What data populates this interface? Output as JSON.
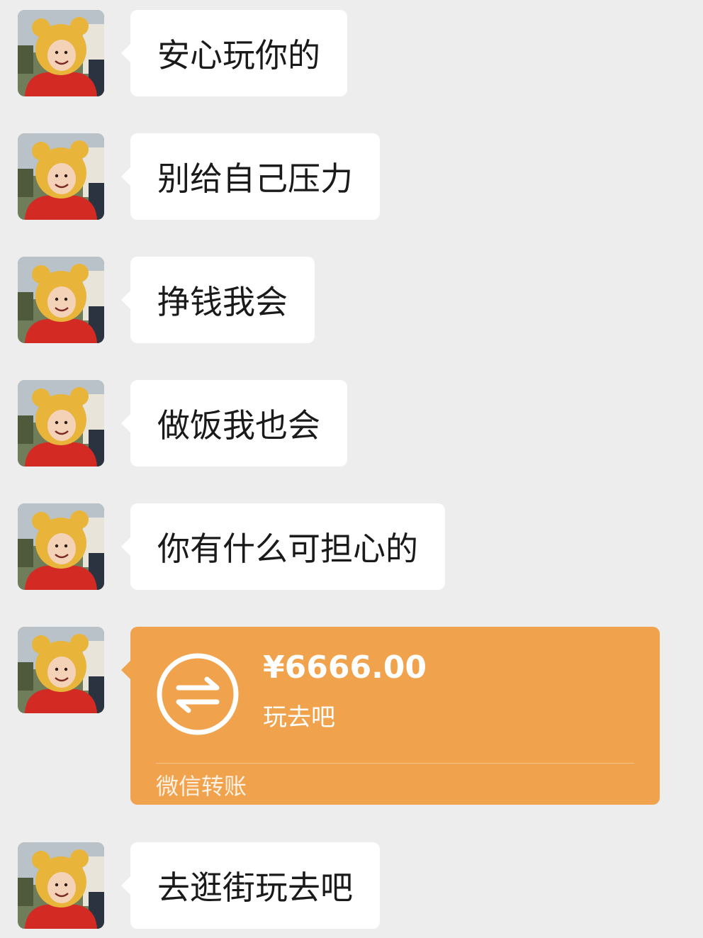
{
  "colors": {
    "background": "#ededed",
    "bubble": "#ffffff",
    "transfer_accent": "#f0a34c",
    "text": "#1a1a1a"
  },
  "avatar": {
    "icon": "avatar-child-in-bear-costume"
  },
  "messages": [
    {
      "text": "安心玩你的"
    },
    {
      "text": "别给自己压力"
    },
    {
      "text": "挣钱我会"
    },
    {
      "text": "做饭我也会"
    },
    {
      "text": "你有什么可担心的"
    },
    {
      "text": "去逛街玩去吧"
    }
  ],
  "transfer": {
    "amount": "¥6666.00",
    "note": "玩去吧",
    "label": "微信转账",
    "icon": "transfer-arrows-icon"
  }
}
